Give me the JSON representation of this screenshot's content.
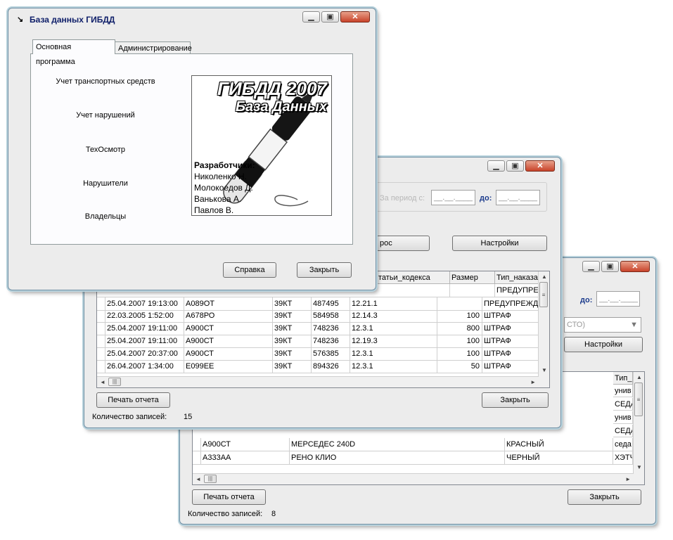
{
  "main_window": {
    "title": "База данных ГИБДД",
    "tabs": [
      "Основная программа",
      "Администрирование"
    ],
    "menu": [
      "Учет транспортных средств",
      "Учет нарушений",
      "ТехОсмотр",
      "Нарушители",
      "Владельцы"
    ],
    "logo": {
      "title": "ГИБДД 2007",
      "subtitle": "База Данных",
      "dev_heading": "Разработчики:",
      "developers": [
        "Николенко Н.",
        "Молокоедов Д.",
        "Ванькова А.",
        "Павлов В."
      ]
    },
    "help_button": "Справка",
    "close_button": "Закрыть"
  },
  "violations_window": {
    "period_label": "За период с:",
    "to_label": "до:",
    "date_mask": "__.__.____",
    "query_button_partial": "рос",
    "settings_button": "Настройки",
    "headers": [
      "татьи_кодекса",
      "Размер",
      "Тип_наказания"
    ],
    "rows": [
      [
        "",
        "",
        "",
        "",
        "",
        "",
        "ПРЕДУПРЕЖДЕ"
      ],
      [
        "25.04.2007 19:13:00",
        "А089ОТ",
        "39КТ",
        "487495",
        "12.21.1",
        "",
        "ПРЕДУПРЕЖДЕ"
      ],
      [
        "22.03.2005 1:52:00",
        "А678РО",
        "39КТ",
        "584958",
        "12.14.3",
        "100",
        "ШТРАФ"
      ],
      [
        "25.04.2007 19:11:00",
        "А900СТ",
        "39КТ",
        "748236",
        "12.3.1",
        "800",
        "ШТРАФ"
      ],
      [
        "25.04.2007 19:11:00",
        "А900СТ",
        "39КТ",
        "748236",
        "12.19.3",
        "100",
        "ШТРАФ"
      ],
      [
        "25.04.2007 20:37:00",
        "А900СТ",
        "39КТ",
        "576385",
        "12.3.1",
        "100",
        "ШТРАФ"
      ],
      [
        "26.04.2007 1:34:00",
        "Е099ЕЕ",
        "39КТ",
        "894326",
        "12.3.1",
        "50",
        "ШТРАФ"
      ]
    ],
    "print_button": "Печать отчета",
    "close_button": "Закрыть",
    "count_label": "Количество записей:",
    "count_value": "15"
  },
  "vehicles_window": {
    "to_label": "до:",
    "date_mask": "__.__.____",
    "combo_partial": "СТО)",
    "settings_button": "Настройки",
    "header_last": "Тип_",
    "type_column_above": [
      "унив",
      "СЕДА",
      "унив",
      "СЕДА"
    ],
    "rows": [
      [
        "А900СТ",
        "МЕРСЕДЕС 240D",
        "КРАСНЫЙ",
        "седа"
      ],
      [
        "А333АА",
        "РЕНО КЛИО",
        "ЧЕРНЫЙ",
        "ХЭТЧ"
      ]
    ],
    "print_button": "Печать отчета",
    "close_button": "Закрыть",
    "count_label": "Количество записей:",
    "count_value": "8"
  },
  "icons": [
    "restore-icon",
    "minimize-icon",
    "maximize-icon",
    "close-icon",
    "pen-icon"
  ]
}
